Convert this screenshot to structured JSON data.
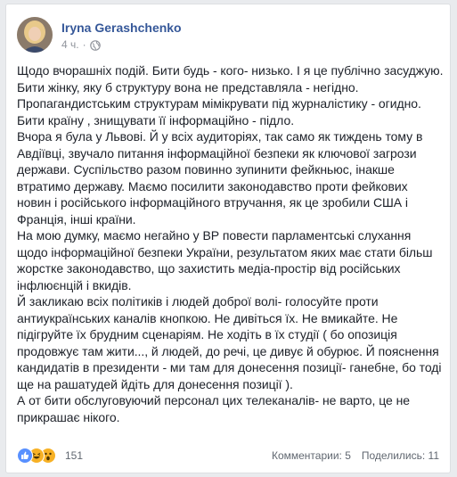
{
  "post": {
    "author": "Iryna Gerashchenko",
    "time": "4 ч.",
    "dot": "·",
    "paragraphs": [
      "Щодо вчорашніх подій. Бити будь - кого- низько. І я це публічно засуджую. Бити жінку, яку б структуру вона не представляла - негідно. Пропагандистським структурам мімікрувати під журналістику - огидно. Бити країну , знищувати її інформаційно - підло.",
      "Вчора я була у Львові. Й у всіх аудиторіях, так само як тиждень тому в Авдіївці, звучало питання інформаційної безпеки як ключової загрози держави. Суспільство разом повинно зупинити фейкньюс, інакше втратимо державу. Маємо посилити законодавство проти фейкових новин і російського інформаційного втручання, як це зробили США і Франція, інші країни.",
      "На мою думку, маємо негайно у ВР повести парламентські слухання щодо інформаційної безпеки України, результатом яких має стати більш жорстке законодавство, що захистить медіа-простір від російських інфлюєнцій і вкидів.",
      "Й закликаю всіх політиків і людей доброї волі- голосуйте проти антиукраїнських каналів кнопкою. Не дивіться їх. Не вмикайте. Не підігруйте їх брудним сценаріям. Не ходіть в їх студії ( бо опозиція продовжує там жити..., й людей, до речі, це дивує й обурює. Й пояснення кандидатів в президенти - ми там для донесення позиції- ганебне, бо тоді ще на рашатудей йдіть для донесення позиції ).",
      "А от бити обслуговуючий персонал цих телеканалів- не варто, це не прикрашає нікого."
    ]
  },
  "footer": {
    "reactions_count": "151",
    "comments": "Комментарии: 5",
    "shares": "Поделились: 11"
  },
  "colors": {
    "author": "#365899",
    "like": "#5890ff",
    "haha": "#f7b125",
    "wow": "#f7b125"
  },
  "icons": [
    "globe-icon",
    "like-reaction-icon",
    "haha-reaction-icon",
    "wow-reaction-icon"
  ]
}
